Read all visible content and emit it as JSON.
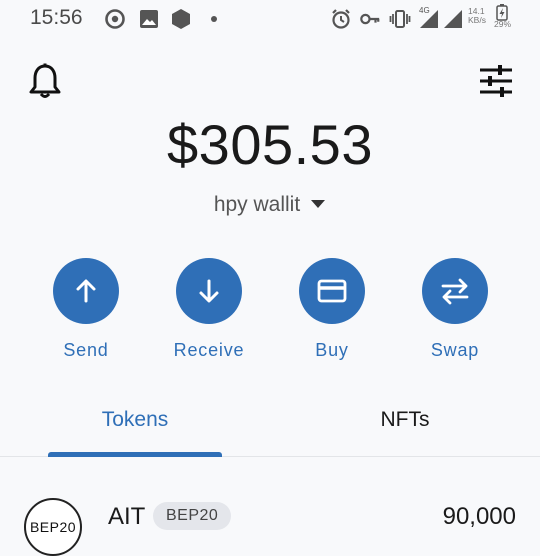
{
  "status_bar": {
    "time": "15:56",
    "net_speed_value": "14.1",
    "net_speed_unit": "KB/s",
    "network_type": "4G",
    "battery_percent": "29%"
  },
  "header": {
    "balance": "$305.53",
    "wallet_name": "hpy wallit"
  },
  "actions": [
    {
      "label": "Send",
      "icon": "arrow-up-icon"
    },
    {
      "label": "Receive",
      "icon": "arrow-down-icon"
    },
    {
      "label": "Buy",
      "icon": "card-icon"
    },
    {
      "label": "Swap",
      "icon": "swap-icon"
    }
  ],
  "tabs": [
    {
      "label": "Tokens",
      "active": true
    },
    {
      "label": "NFTs",
      "active": false
    }
  ],
  "tokens": [
    {
      "logo_text": "BEP20",
      "name": "AIT",
      "network_badge": "BEP20",
      "amount": "90,000"
    }
  ],
  "colors": {
    "accent": "#2f6fb7",
    "background": "#f8f9fb",
    "badge_bg": "#e4e6eb"
  }
}
